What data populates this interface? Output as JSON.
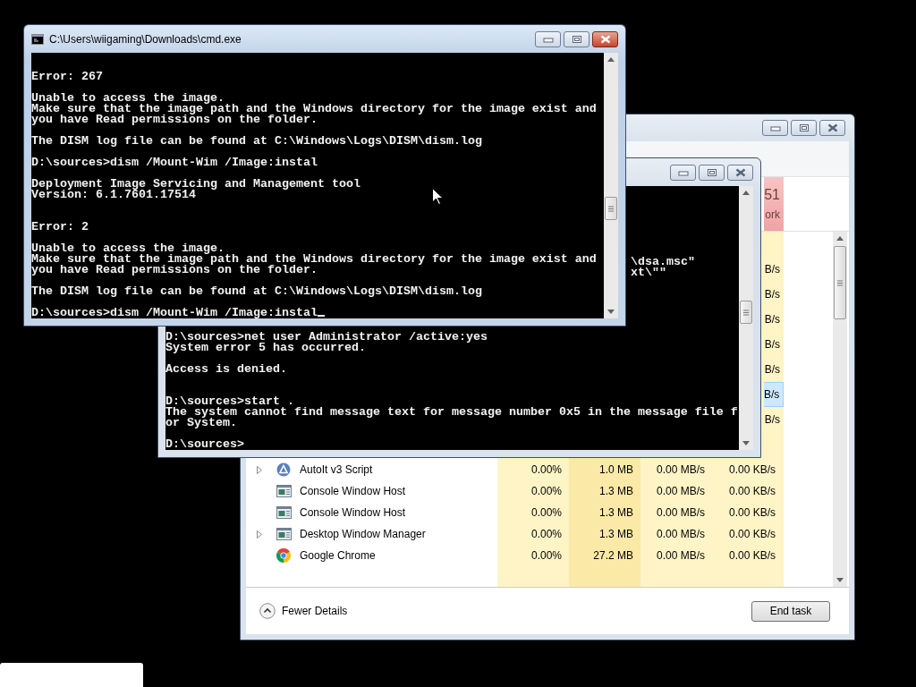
{
  "task_manager": {
    "network_header": {
      "value": "51",
      "label": "ork",
      "alert": true
    },
    "partial_rows": [
      {
        "network": "B/s",
        "selected": false
      },
      {
        "network": "B/s",
        "selected": false
      },
      {
        "network": "B/s",
        "selected": false
      },
      {
        "network": "B/s",
        "selected": false
      },
      {
        "network": "B/s",
        "selected": false
      },
      {
        "network": "B/s",
        "selected": true
      },
      {
        "network": "B/s",
        "selected": false
      }
    ],
    "rows": [
      {
        "name": "AutoIt v3 Script",
        "kind": "script",
        "expandable": true,
        "cpu": "0.00%",
        "memory": "1.0 MB",
        "disk": "0.00 MB/s",
        "network": "0.00 KB/s",
        "selected": false
      },
      {
        "name": "Console Window Host",
        "kind": "console",
        "expandable": false,
        "cpu": "0.00%",
        "memory": "1.3 MB",
        "disk": "0.00 MB/s",
        "network": "0.00 KB/s",
        "selected": false
      },
      {
        "name": "Console Window Host",
        "kind": "console",
        "expandable": false,
        "cpu": "0.00%",
        "memory": "1.3 MB",
        "disk": "0.00 MB/s",
        "network": "0.00 KB/s",
        "selected": false
      },
      {
        "name": "Desktop Window Manager",
        "kind": "console",
        "expandable": true,
        "cpu": "0.00%",
        "memory": "1.3 MB",
        "disk": "0.00 MB/s",
        "network": "0.00 KB/s",
        "selected": false
      },
      {
        "name": "Google Chrome",
        "kind": "chrome",
        "expandable": false,
        "cpu": "0.00%",
        "memory": "27.2 MB",
        "disk": "0.00 MB/s",
        "network": "0.00 KB/s",
        "selected": false
      }
    ],
    "fewer_details": "Fewer Details",
    "end_task": "End task"
  },
  "back_console": {
    "active": false,
    "blocks": [
      {
        "kind": "tail",
        "cursor": false,
        "lines": [
          "\\dsa.msc\"",
          "xt\\\"\""
        ]
      },
      {
        "kind": "text",
        "cursor": false,
        "lines": [
          "D:\\sources>net user Administrator /active:yes",
          "System error 5 has occurred."
        ]
      },
      {
        "kind": "text",
        "cursor": false,
        "lines": [
          "Access is denied."
        ]
      },
      {
        "kind": "text",
        "cursor": false,
        "lines": [
          "D:\\sources>start .",
          "The system cannot find message text for message number 0x5 in the message file f",
          "or System."
        ]
      },
      {
        "kind": "text",
        "cursor": false,
        "lines": [
          "D:\\sources>"
        ]
      }
    ]
  },
  "front_console": {
    "title": "C:\\Users\\wiigaming\\Downloads\\cmd.exe",
    "active": true,
    "blocks": [
      {
        "kind": "text",
        "cursor": false,
        "lines": [
          "Error: 267"
        ]
      },
      {
        "kind": "text",
        "cursor": false,
        "lines": [
          "Unable to access the image.",
          "Make sure that the image path and the Windows directory for the image exist and",
          "you have Read permissions on the folder."
        ]
      },
      {
        "kind": "text",
        "cursor": false,
        "lines": [
          "The DISM log file can be found at C:\\Windows\\Logs\\DISM\\dism.log"
        ]
      },
      {
        "kind": "text",
        "cursor": false,
        "lines": [
          "D:\\sources>dism /Mount-Wim /Image:instal"
        ]
      },
      {
        "kind": "text",
        "cursor": false,
        "lines": [
          "Deployment Image Servicing and Management tool",
          "Version: 6.1.7601.17514"
        ]
      },
      {
        "kind": "text",
        "cursor": false,
        "lines": [
          "Error: 2"
        ]
      },
      {
        "kind": "text",
        "cursor": false,
        "lines": [
          "Unable to access the image.",
          "Make sure that the image path and the Windows directory for the image exist and",
          "you have Read permissions on the folder."
        ]
      },
      {
        "kind": "text",
        "cursor": false,
        "lines": [
          "The DISM log file can be found at C:\\Windows\\Logs\\DISM\\dism.log"
        ]
      },
      {
        "kind": "text",
        "cursor": true,
        "lines": [
          "D:\\sources>dism /Mount-Wim /Image:instal"
        ]
      }
    ]
  }
}
